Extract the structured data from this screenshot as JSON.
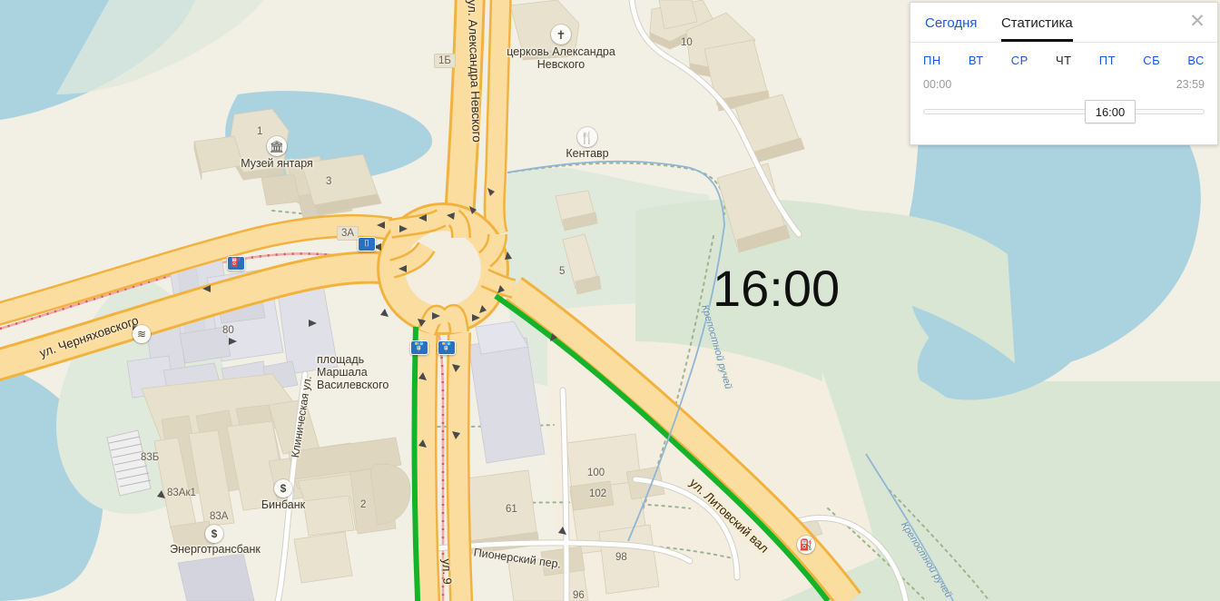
{
  "overlay": {
    "big_time": "16:00"
  },
  "panel": {
    "tabs": [
      {
        "label": "Сегодня",
        "active": false
      },
      {
        "label": "Статистика",
        "active": true
      }
    ],
    "close_label": "✕",
    "days": [
      {
        "label": "ПН",
        "active": false
      },
      {
        "label": "ВТ",
        "active": false
      },
      {
        "label": "СР",
        "active": false
      },
      {
        "label": "ЧТ",
        "active": true
      },
      {
        "label": "ПТ",
        "active": false
      },
      {
        "label": "СБ",
        "active": false
      },
      {
        "label": "ВС",
        "active": false
      }
    ],
    "time_start": "00:00",
    "time_end": "23:59",
    "slider_value": "16:00",
    "accent_color": "#1a5ad7"
  },
  "map": {
    "pois": [
      {
        "name": "Музей янтаря",
        "icon": "museum-icon",
        "glyph": "🏛"
      },
      {
        "name": "церковь Александра Невского",
        "icon": "church-icon",
        "glyph": "✝"
      },
      {
        "name": "Кентавр",
        "icon": "restaurant-icon",
        "glyph": "🍴"
      },
      {
        "name": "Бинбанк",
        "icon": "bank-icon",
        "glyph": "$"
      },
      {
        "name": "Энерготрансбанк",
        "icon": "bank-icon",
        "glyph": "$"
      }
    ],
    "labels": {
      "museum": "Музей янтаря",
      "church_line1": "церковь Александра",
      "church_line2": "Невского",
      "restaurant": "Кентавр",
      "bank1": "Бинбанк",
      "bank2": "Энерготрансбанк",
      "square_line1": "площадь",
      "square_line2": "Маршала",
      "square_line3": "Василевского"
    },
    "streets": {
      "nevskogo": "ул. Александра Невского",
      "chernyahovskogo": "ул. Черняховского",
      "litovsky_val": "ул. Литовский вал",
      "klinicheskaya": "Клиническая ул.",
      "pionersky": "Пионерский пер.",
      "ul9": "ул. 9"
    },
    "water": {
      "creek1": "Крепостной ручей",
      "creek2": "Крепостной ручей"
    },
    "house_numbers": [
      "1Б",
      "1",
      "3",
      "3А",
      "10",
      "5",
      "80",
      "83Б",
      "83Ак1",
      "83А",
      "2",
      "100",
      "102",
      "61",
      "98",
      "96"
    ],
    "colors": {
      "land": "#f2efe4",
      "water": "#aad3df",
      "park": "#d6e4d0",
      "road_major": "#fcd37f",
      "road_casing": "#f2b23e",
      "building": "#e4ddc8",
      "traffic_green": "#14b32a",
      "traffic_yellow": "#f5c518"
    }
  }
}
